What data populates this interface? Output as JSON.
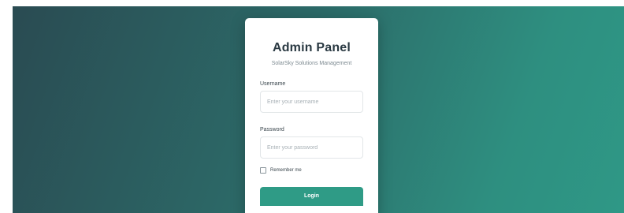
{
  "colors": {
    "background_start": "#2a4b52",
    "background_end": "#2f9886",
    "accent": "#2f9b86",
    "card": "#ffffff"
  },
  "login": {
    "title": "Admin Panel",
    "subtitle": "SolarSky Solutions Management",
    "username_label": "Username",
    "username_placeholder": "Enter your username",
    "username_value": "",
    "password_label": "Password",
    "password_placeholder": "Enter your password",
    "password_value": "",
    "remember_label": "Remember me",
    "remember_checked": false,
    "login_button": "Login"
  }
}
